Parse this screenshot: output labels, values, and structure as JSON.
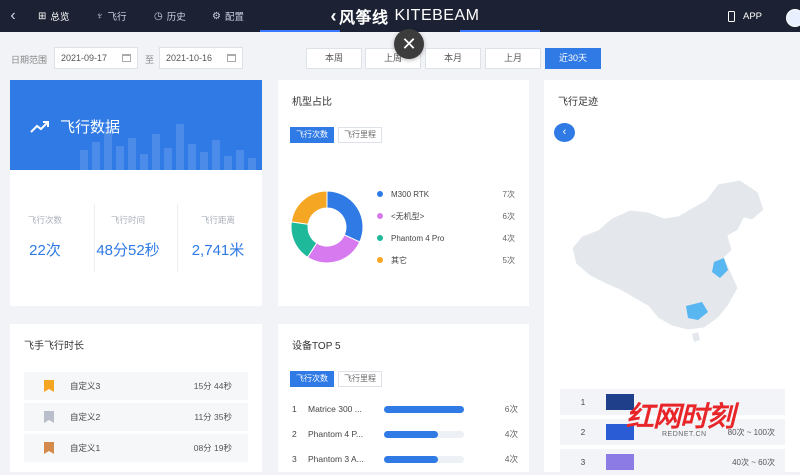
{
  "nav": {
    "back": "‹",
    "tabs": [
      {
        "label": "总览",
        "icon": "dashboard-icon",
        "glyph": "⊞"
      },
      {
        "label": "飞行",
        "icon": "drone-icon",
        "glyph": "♆"
      },
      {
        "label": "历史",
        "icon": "history-icon",
        "glyph": "◷"
      },
      {
        "label": "配置",
        "icon": "settings-icon",
        "glyph": "⚙"
      }
    ],
    "brand_cn": "风筝线",
    "brand_en": "KITEBEAM",
    "app_label": "APP"
  },
  "filter": {
    "range_label": "日期范围",
    "start_date": "2021-09-17",
    "to_label": "至",
    "end_date": "2021-10-16",
    "periods": [
      {
        "label": "本周",
        "active": false
      },
      {
        "label": "上周",
        "active": false
      },
      {
        "label": "本月",
        "active": false
      },
      {
        "label": "上月",
        "active": false
      },
      {
        "label": "近30天",
        "active": true
      }
    ],
    "close_glyph": "✕"
  },
  "flight_data": {
    "title": "飞行数据",
    "stats": [
      {
        "label": "飞行次数",
        "value": "22次"
      },
      {
        "label": "飞行时间",
        "value": "48分52秒"
      },
      {
        "label": "飞行距离",
        "value": "2,741米"
      }
    ]
  },
  "model_share": {
    "title": "机型占比",
    "tabs": [
      "飞行次数",
      "飞行里程"
    ],
    "items": [
      {
        "name": "M300 RTK",
        "count": "7次",
        "value": 7,
        "color": "#2f7ae5"
      },
      {
        "name": "<无机型>",
        "count": "6次",
        "value": 6,
        "color": "#d77af0"
      },
      {
        "name": "Phantom 4 Pro",
        "count": "4次",
        "value": 4,
        "color": "#1db99a"
      },
      {
        "name": "其它",
        "count": "5次",
        "value": 5,
        "color": "#f5a623"
      }
    ]
  },
  "footprint": {
    "title": "飞行足迹",
    "back_glyph": "‹",
    "legend": [
      {
        "rank": "1",
        "color": "#1f3f8a",
        "range": ""
      },
      {
        "rank": "2",
        "color": "#2a5cd6",
        "range": "80次 ~ 100次"
      },
      {
        "rank": "3",
        "color": "#8d7be5",
        "range": "40次 ~ 60次"
      }
    ]
  },
  "pilot_duration": {
    "title": "飞手飞行时长",
    "rows": [
      {
        "name": "自定义3",
        "duration": "15分 44秒",
        "color": "#f5a623"
      },
      {
        "name": "自定义2",
        "duration": "11分 35秒",
        "color": "#b8bfca"
      },
      {
        "name": "自定义1",
        "duration": "08分 19秒",
        "color": "#d48a4a"
      }
    ]
  },
  "device_top5": {
    "title": "设备TOP 5",
    "tabs": [
      "飞行次数",
      "飞行里程"
    ],
    "rows": [
      {
        "rank": "1",
        "name": "Matrice 300 ...",
        "count": "6次",
        "fill": 1.0
      },
      {
        "rank": "2",
        "name": "Phantom 4 P...",
        "count": "4次",
        "fill": 0.67
      },
      {
        "rank": "3",
        "name": "Phantom 3 A...",
        "count": "4次",
        "fill": 0.67
      }
    ]
  },
  "watermark": {
    "text": "红网时刻",
    "sub": "REDNET.CN"
  }
}
